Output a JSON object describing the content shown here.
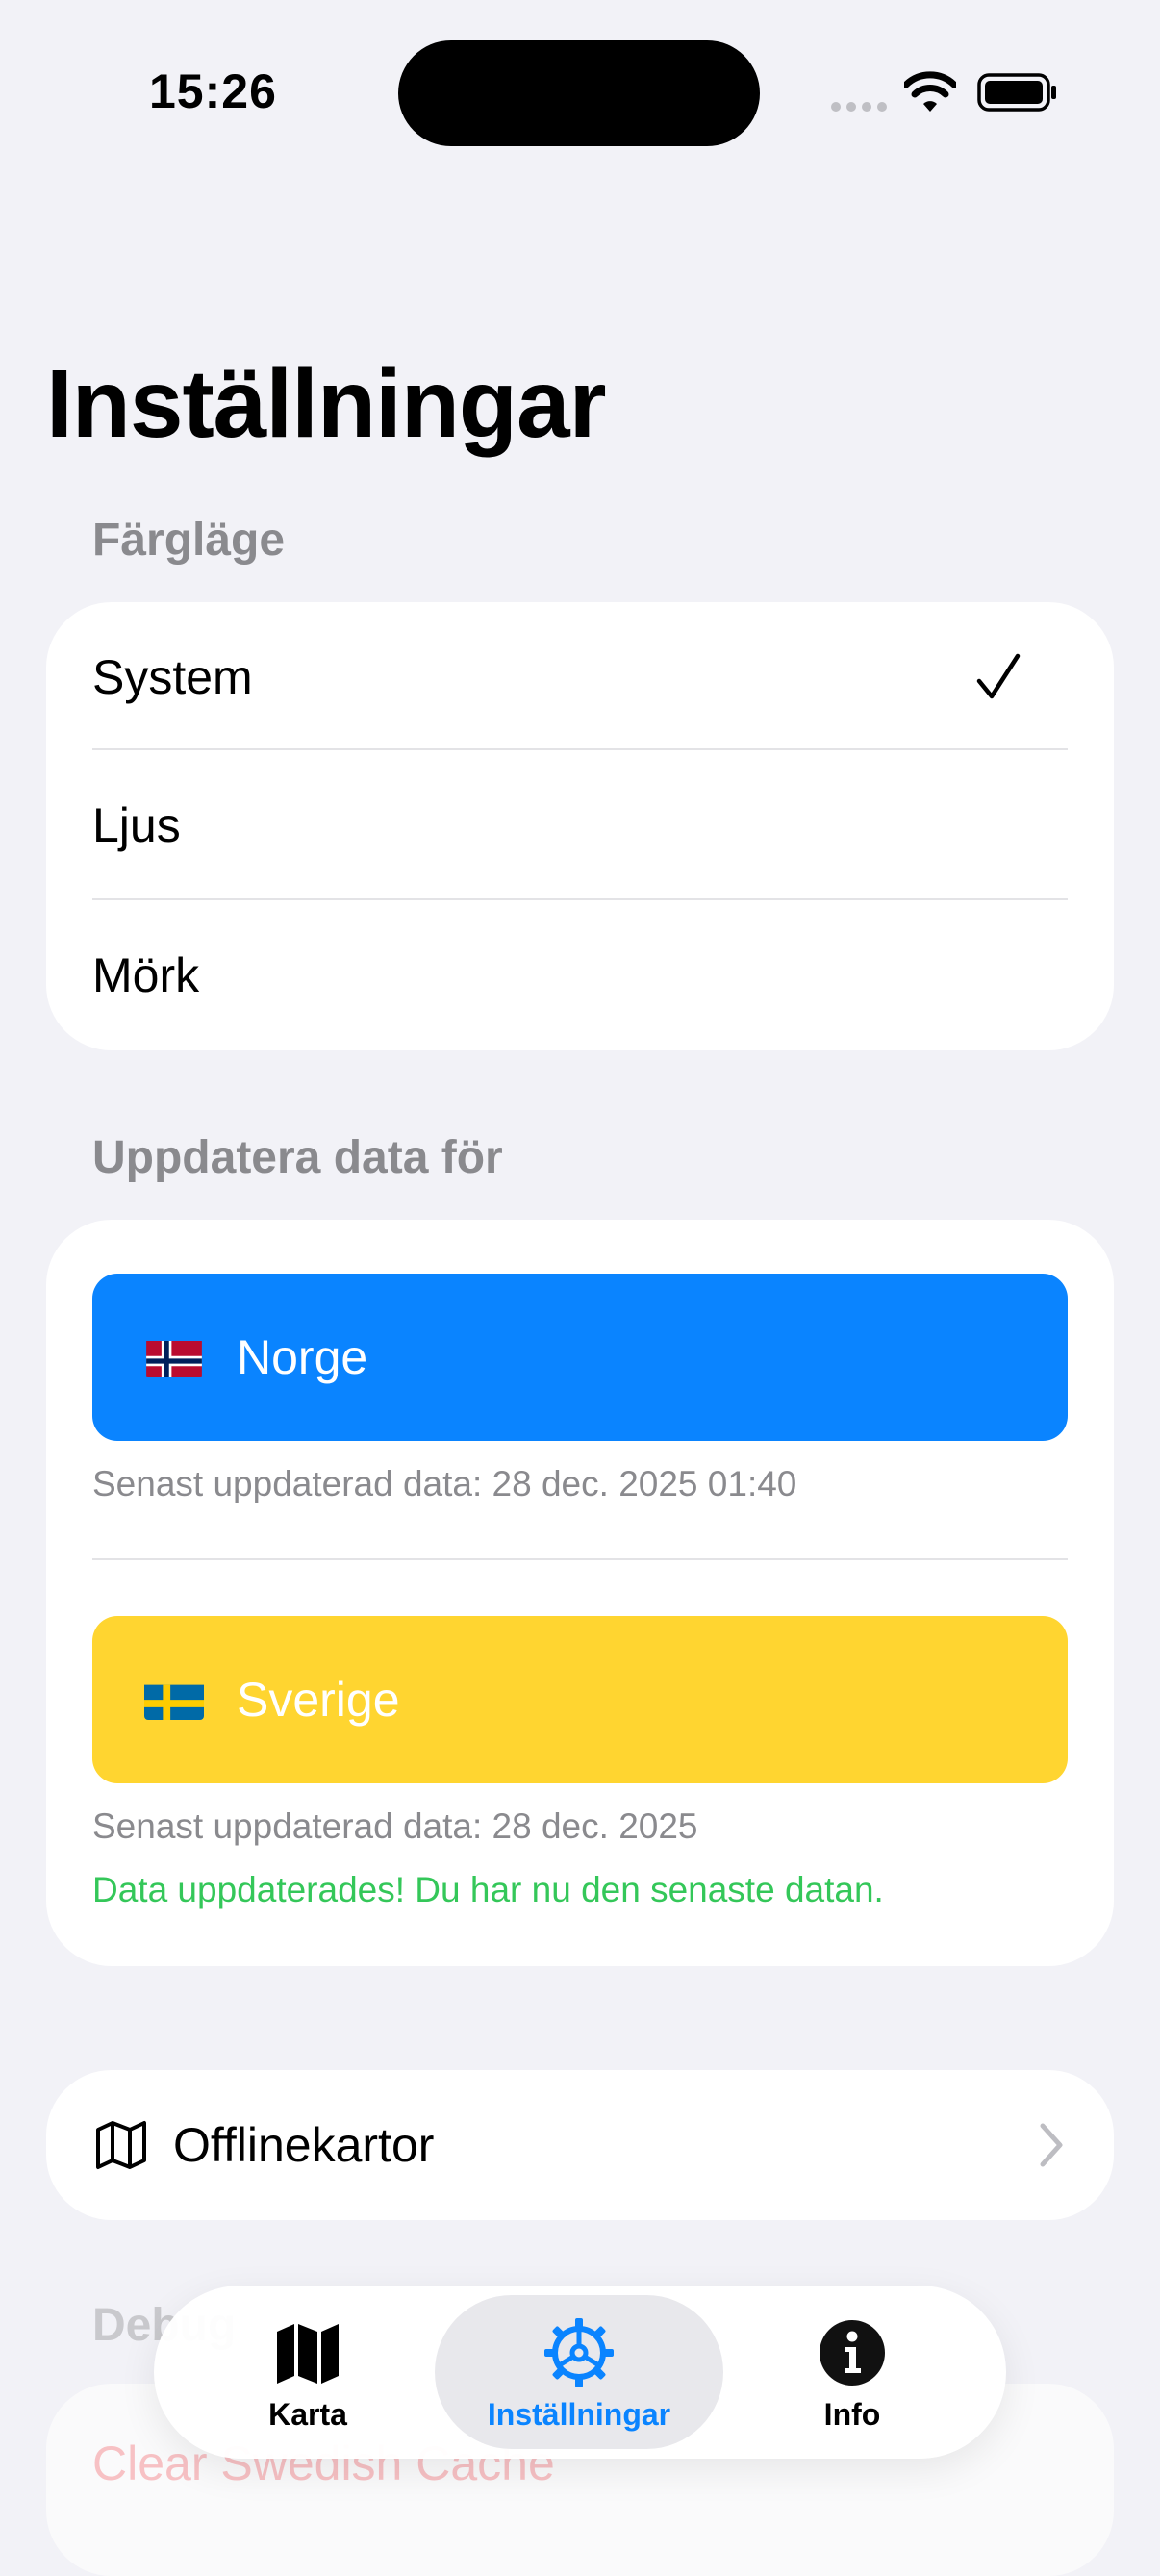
{
  "status_bar": {
    "time": "15:26"
  },
  "page": {
    "title": "Inställningar"
  },
  "color_mode": {
    "header": "Färgläge",
    "options": [
      "System",
      "Ljus",
      "Mörk"
    ],
    "selected": "System"
  },
  "update_data": {
    "header": "Uppdatera data för",
    "norway": {
      "label": "Norge",
      "last_updated": "Senast uppdaterad data: 28 dec. 2025 01:40",
      "color": "#0A84FF"
    },
    "sweden": {
      "label": "Sverige",
      "last_updated": "Senast uppdaterad data: 28 dec. 2025",
      "success": "Data uppdaterades! Du har nu den senaste datan.",
      "color": "#FFD530"
    }
  },
  "offline_maps": {
    "label": "Offlinekartor",
    "icon": "map-icon"
  },
  "debug": {
    "header": "Debug",
    "clear_cache": "Clear Swedish Cache"
  },
  "tabbar": {
    "tabs": [
      {
        "label": "Karta",
        "icon": "map-fill-icon"
      },
      {
        "label": "Inställningar",
        "icon": "gear-icon",
        "active": true
      },
      {
        "label": "Info",
        "icon": "info-circle-icon"
      }
    ],
    "active_color": "#0A84FF"
  }
}
